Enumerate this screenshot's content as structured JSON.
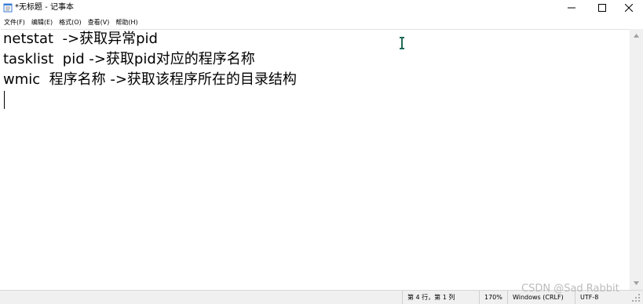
{
  "window": {
    "title": "*无标题 - 记事本"
  },
  "menu": {
    "items": [
      "文件(F)",
      "编辑(E)",
      "格式(O)",
      "查看(V)",
      "帮助(H)"
    ]
  },
  "editor": {
    "lines": [
      "netstat  ->获取异常pid",
      "tasklist  pid ->获取pid对应的程序名称",
      "wmic  程序名称 ->获取该程序所在的目录结构"
    ]
  },
  "status": {
    "position": "第 4 行，第 1 列",
    "zoom": "170%",
    "line_ending": "Windows (CRLF)",
    "encoding": "UTF-8"
  },
  "watermark": "CSDN @Sad Rabbit",
  "colors": {
    "cursor_accent": "#1f6b5a",
    "statusbar_bg": "#f0f0f0"
  }
}
